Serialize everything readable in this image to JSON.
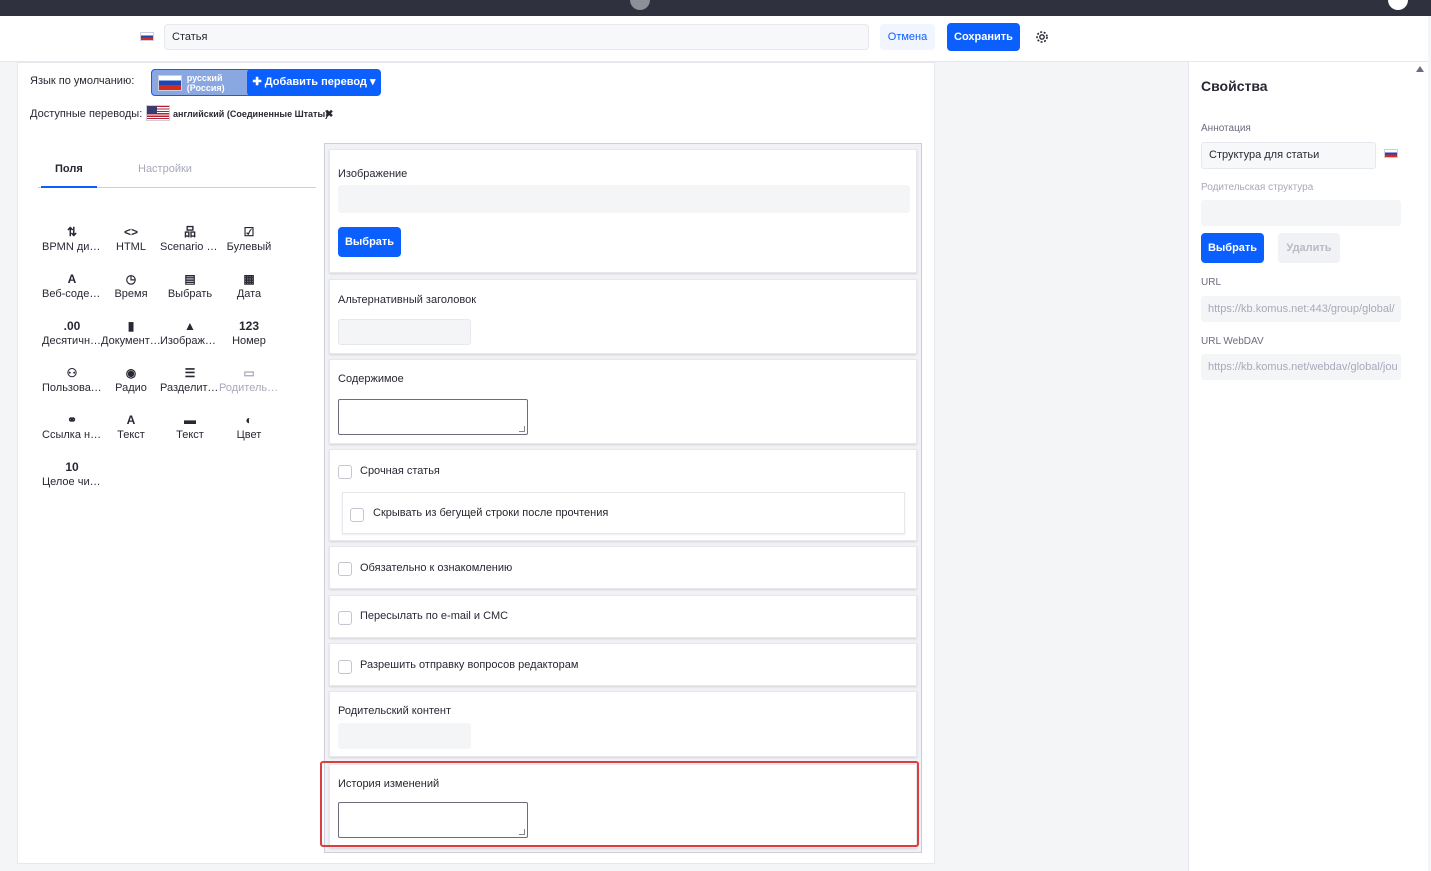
{
  "header": {
    "title_value": "Статья",
    "cancel_label": "Отмена",
    "save_label": "Сохранить"
  },
  "languages": {
    "default_label": "Язык по умолчанию:",
    "default_value": "русский (Россия)",
    "add_translation_label": "Добавить перевод",
    "available_label": "Доступные переводы:",
    "available_value": "английский (Соединенные Штаты)"
  },
  "tabs": [
    {
      "label": "Поля",
      "active": true
    },
    {
      "label": "Настройки",
      "active": false
    }
  ],
  "palette": [
    {
      "icon": "bpmn-icon",
      "glyph": "⇅",
      "label": "BPMN диаграмма"
    },
    {
      "icon": "html-icon",
      "glyph": "<>",
      "label": "HTML"
    },
    {
      "icon": "scenario-icon",
      "glyph": "品",
      "label": "Scenario Editor"
    },
    {
      "icon": "checkbox-icon",
      "glyph": "☑",
      "label": "Булевый"
    },
    {
      "icon": "web-content-icon",
      "glyph": "A",
      "label": "Веб-содержимое"
    },
    {
      "icon": "clock-icon",
      "glyph": "◷",
      "label": "Время"
    },
    {
      "icon": "select-icon",
      "glyph": "▤",
      "label": "Выбрать"
    },
    {
      "icon": "calendar-icon",
      "glyph": "▦",
      "label": "Дата"
    },
    {
      "icon": "decimal-icon",
      "glyph": ".00",
      "label": "Десятичное"
    },
    {
      "icon": "document-icon",
      "glyph": "▮",
      "label": "Документы и медиа"
    },
    {
      "icon": "image-icon",
      "glyph": "▲",
      "label": "Изображение"
    },
    {
      "icon": "number-icon",
      "glyph": "123",
      "label": "Номер"
    },
    {
      "icon": "user-icon",
      "glyph": "⚇",
      "label": "Пользователь"
    },
    {
      "icon": "radio-icon",
      "glyph": "◉",
      "label": "Радио"
    },
    {
      "icon": "separator-icon",
      "glyph": "☰",
      "label": "Разделитель"
    },
    {
      "icon": "parent-icon",
      "glyph": "▭",
      "label": "Родительский контент",
      "disabled": true
    },
    {
      "icon": "link-icon",
      "glyph": "⚭",
      "label": "Ссылка на страницу"
    },
    {
      "icon": "text-icon",
      "glyph": "A",
      "label": "Текст"
    },
    {
      "icon": "text-box-icon",
      "glyph": "▬",
      "label": "Текст"
    },
    {
      "icon": "color-icon",
      "glyph": "◐",
      "label": "Цвет"
    },
    {
      "icon": "integer-icon",
      "glyph": "10",
      "label": "Целое число"
    }
  ],
  "form": {
    "image_label": "Изображение",
    "select_button": "Выбрать",
    "alt_title_label": "Альтернативный заголовок",
    "content_label": "Содержимое",
    "urgent_label": "Срочная статья",
    "hide_ticker_label": "Скрывать из бегущей строки после прочтения",
    "mandatory_label": "Обязательно к ознакомлению",
    "forward_label": "Пересылать по e-mail и СМС",
    "questions_label": "Разрешить отправку вопросов редакторам",
    "parent_content_label": "Родительский контент",
    "history_label": "История изменений"
  },
  "properties": {
    "title": "Свойства",
    "annotation_label": "Аннотация",
    "annotation_value": "Структура для статьи",
    "parent_structure_label": "Родительская структура",
    "select_button": "Выбрать",
    "delete_button": "Удалить",
    "url_label": "URL",
    "url_value": "https://kb.komus.net:443/group/global/",
    "webdav_label": "URL WebDAV",
    "webdav_value": "https://kb.komus.net/webdav/global/jou"
  }
}
